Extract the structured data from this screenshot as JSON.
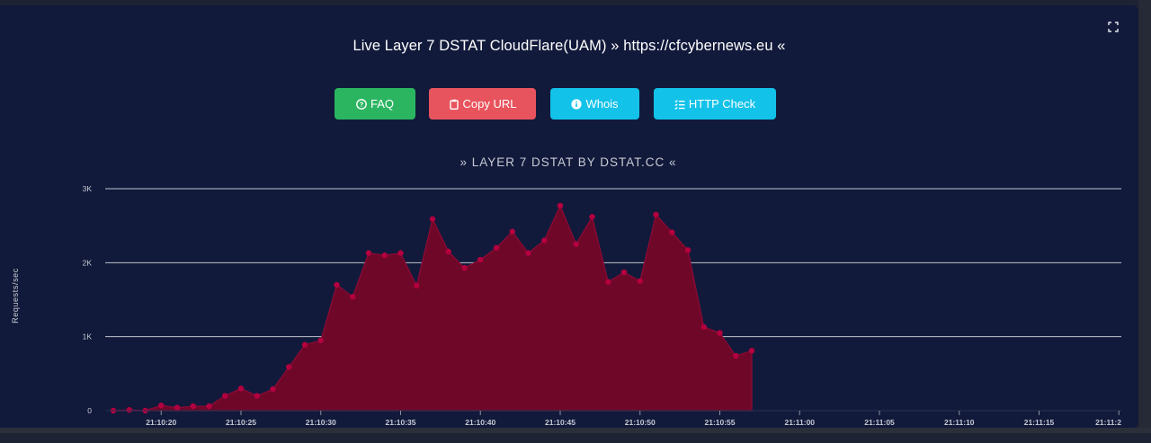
{
  "page": {
    "title": "Live Layer 7 DSTAT CloudFlare(UAM) » https://cfcybernews.eu «",
    "expand_icon": "fullscreen-icon"
  },
  "buttons": [
    {
      "label": "FAQ",
      "icon": "question-circle-icon",
      "color": "#2bb561"
    },
    {
      "label": "Copy URL",
      "icon": "clipboard-icon",
      "color": "#e8545d"
    },
    {
      "label": "Whois",
      "icon": "info-circle-icon",
      "color": "#12c2e9"
    },
    {
      "label": "HTTP Check",
      "icon": "list-check-icon",
      "color": "#12c2e9"
    }
  ],
  "colors": {
    "panel_bg": "#121a3b",
    "area_fill": "#6f0729",
    "area_stroke": "#8d0a35",
    "grid": "#bfc3cc",
    "title_text": "#ffffff",
    "axis_text": "#c7cad3"
  },
  "chart_data": {
    "type": "area",
    "title": "» LAYER 7 DSTAT BY DSTAT.CC «",
    "ylabel": "Requests/sec",
    "xlabel": "",
    "ylim": [
      0,
      3000
    ],
    "y_ticks": [
      0,
      1000,
      2000,
      3000
    ],
    "y_tick_labels": [
      "0",
      "1K",
      "2K",
      "3K"
    ],
    "x_tick_labels": [
      "21:10:20",
      "21:10:25",
      "21:10:30",
      "21:10:35",
      "21:10:40",
      "21:10:45",
      "21:10:50",
      "21:10:55",
      "21:11:00",
      "21:11:05",
      "21:11:10",
      "21:11:15",
      "21:11:2"
    ],
    "grid": true,
    "legend": "none",
    "x_start": "21:10:17",
    "x_step_seconds": 1,
    "series": [
      {
        "values": [
          0,
          10,
          0,
          70,
          40,
          60,
          60,
          200,
          300,
          200,
          290,
          590,
          890,
          950,
          1700,
          1540,
          2130,
          2100,
          2130,
          1690,
          2590,
          2150,
          1930,
          2040,
          2200,
          2420,
          2130,
          2300,
          2770,
          2250,
          2620,
          1740,
          1870,
          1750,
          2650,
          2410,
          2170,
          1130,
          1050,
          740,
          810
        ]
      }
    ]
  }
}
